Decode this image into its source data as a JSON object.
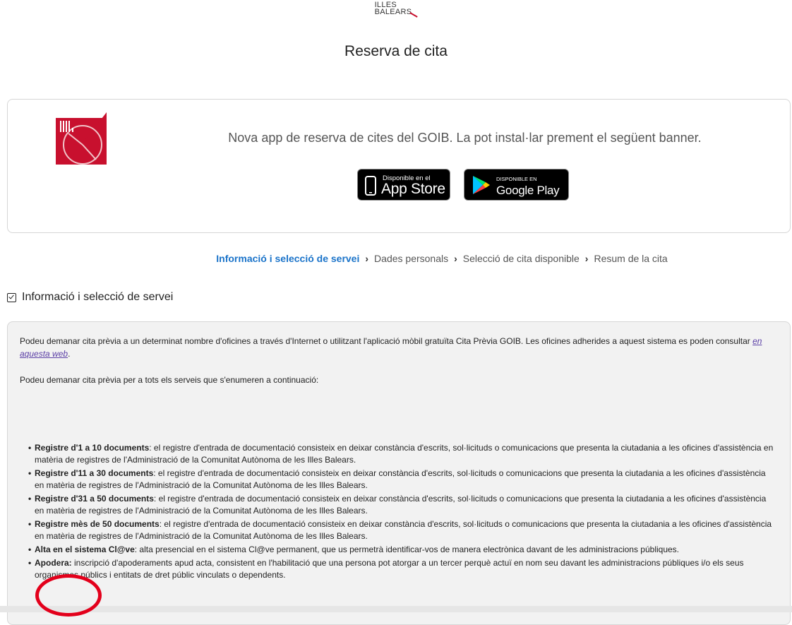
{
  "logo": {
    "line1": "ILLES",
    "line2": "BALEARS"
  },
  "title": "Reserva de cita",
  "banner": {
    "text": "Nova app de reserva de cites del GOIB. La pot instal·lar prement el següent banner.",
    "appstore": {
      "small": "Disponible en el",
      "big": "App Store"
    },
    "googleplay": {
      "small": "DISPONIBLE EN",
      "big": "Google Play"
    }
  },
  "stepper": {
    "steps": [
      "Informació i selecció de servei",
      "Dades personals",
      "Selecció de cita disponible",
      "Resum de la cita"
    ],
    "separator": "›"
  },
  "section": {
    "title": "Informació i selecció de servei"
  },
  "info": {
    "p1_before": "Podeu demanar cita prèvia a un determinat nombre d'oficines a través d'Internet o utilitzant l'aplicació mòbil gratuïta Cita Prèvia GOIB. Les oficines adherides a aquest sistema es poden consultar ",
    "p1_link": "en aquesta web",
    "p1_after": ".",
    "p2": "Podeu demanar cita prèvia per a tots els serveis que s'enumeren a continuació:",
    "services": [
      {
        "name": "Registre d'1 a 10 documents",
        "desc": ": el registre d'entrada de documentació consisteix en deixar constància d'escrits, sol·licituds o comunicacions que presenta la ciutadania a les oficines d'assistència en matèria de registres de l'Administració de la Comunitat Autònoma de les Illes Balears."
      },
      {
        "name": "Registre d'11 a 30 documents",
        "desc": ": el registre d'entrada de documentació consisteix en deixar constància d'escrits, sol·licituds o comunicacions que presenta la ciutadania a les oficines d'assistència en matèria de registres de l'Administració de la Comunitat Autònoma de les Illes Balears."
      },
      {
        "name": "Registre d'31 a 50 documents",
        "desc": ": el registre d'entrada de documentació consisteix en deixar constància d'escrits, sol·licituds o comunicacions que presenta la ciutadania a les oficines d'assistència en matèria de registres de l'Administració de la Comunitat Autònoma de les Illes Balears."
      },
      {
        "name": "Registre mès de 50 documents",
        "desc": ": el registre d'entrada de documentació consisteix en deixar constància d'escrits, sol·licituds o comunicacions que presenta la ciutadania a les oficines d'assistència en matèria de registres de l'Administració de la Comunitat Autònoma de les Illes Balears."
      },
      {
        "name": "Alta en el sistema Cl@ve",
        "desc": ": alta presencial en el sistema Cl@ve permanent, que us permetrà identificar-vos de manera electrònica davant de les administracions públiques."
      },
      {
        "name": "Apodera:",
        "desc": " inscripció d'apoderaments apud acta, consistent en l'habilitació que una persona pot atorgar a un tercer perquè actuï en nom seu davant les administracions públiques i/o els seus organismes públics i entitats de dret públic vinculats o dependents."
      }
    ]
  },
  "colors": {
    "active_step": "#1a73c9",
    "brand_red": "#c8102e",
    "annotation_red": "#e3001b"
  }
}
